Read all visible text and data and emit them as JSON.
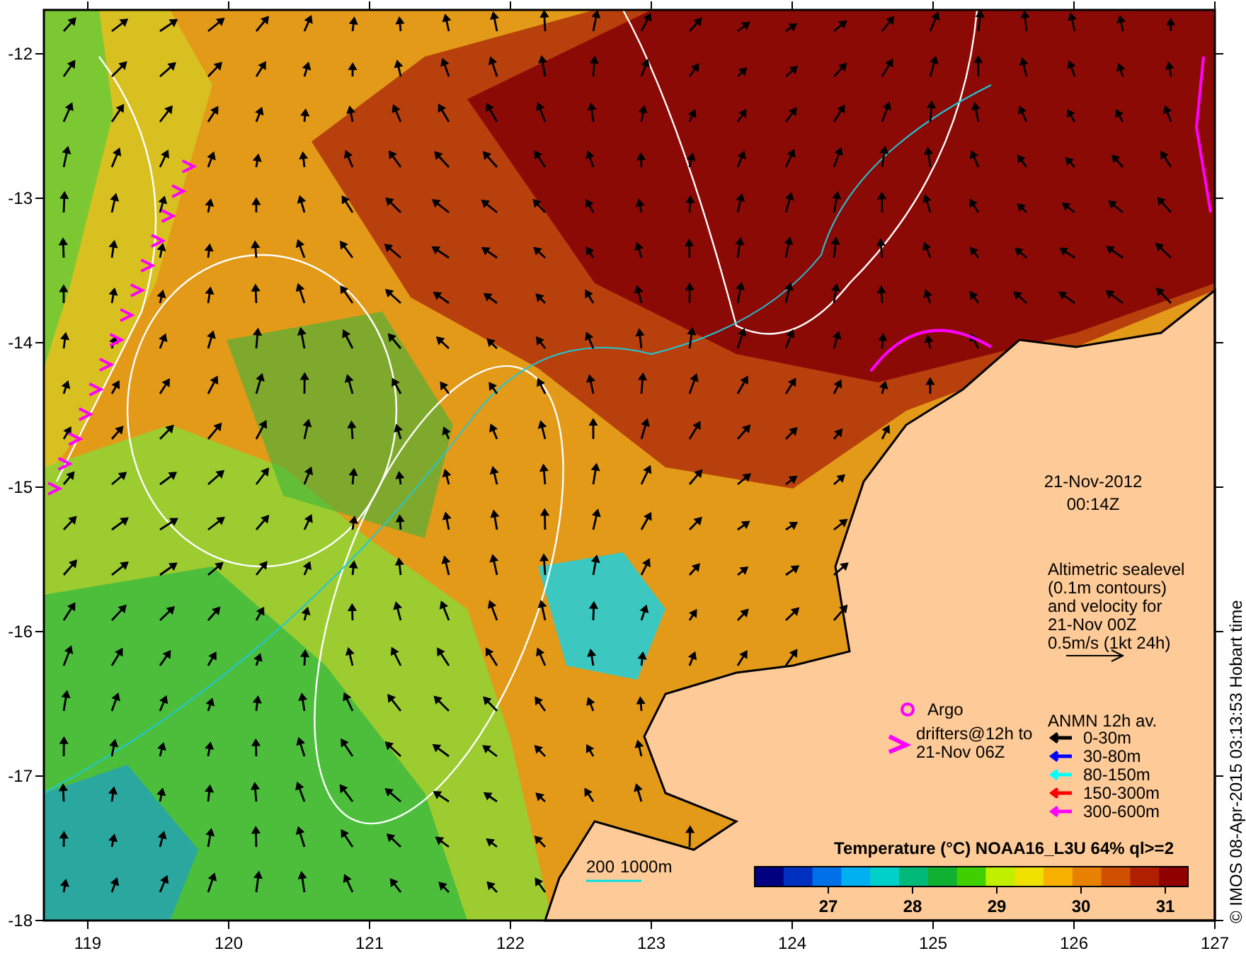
{
  "map": {
    "x_ticks": [
      "119",
      "120",
      "121",
      "122",
      "123",
      "124",
      "125",
      "126",
      "127"
    ],
    "y_ticks": [
      "-12",
      "-13",
      "-14",
      "-15",
      "-16",
      "-17",
      "-18"
    ],
    "date": "21-Nov-2012",
    "time": "00:14Z",
    "altimetry_note": [
      "Altimetric sealevel",
      "(0.1m contours)",
      "and velocity for",
      "21-Nov 00Z",
      "0.5m/s (1kt 24h)"
    ],
    "argo_label": "Argo",
    "drifters_label": [
      "drifters@12h to",
      "21-Nov 06Z"
    ],
    "anmn": {
      "title": "ANMN 12h av.",
      "items": [
        {
          "label": "0-30m",
          "color": "#000000"
        },
        {
          "label": "30-80m",
          "color": "#0000ff"
        },
        {
          "label": "80-150m",
          "color": "#00ffff"
        },
        {
          "label": "150-300m",
          "color": "#ff0000"
        },
        {
          "label": "300-600m",
          "color": "#ff00ff"
        }
      ]
    },
    "isobath_labels": [
      "200",
      "1000m"
    ],
    "colorbar": {
      "title": "Temperature (°C) NOAA16_L3U 64% ql>=2",
      "ticks": [
        "27",
        "28",
        "29",
        "30",
        "31"
      ]
    },
    "credit": "© IMOS 08-Apr-2015 03:13:53 Hobart time"
  }
}
